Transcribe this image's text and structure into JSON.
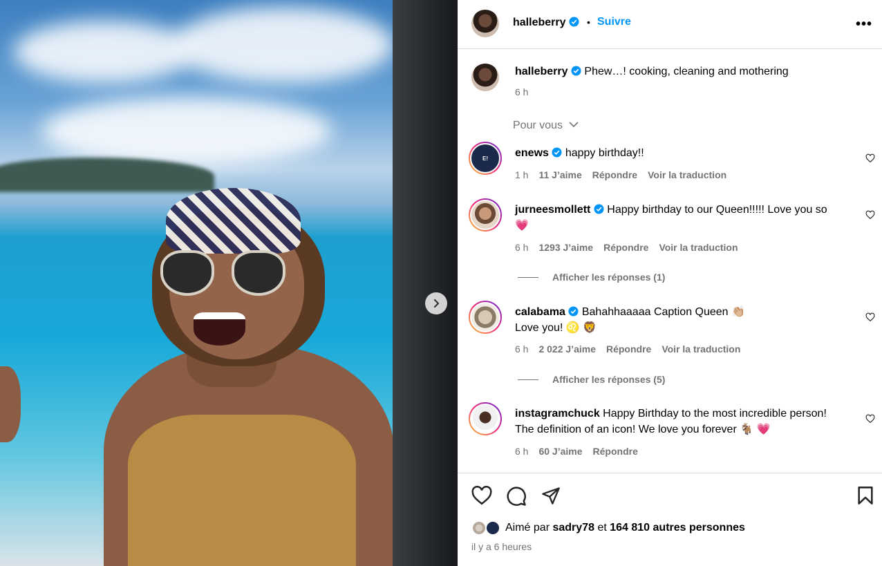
{
  "post": {
    "username": "halleberry",
    "separator": "•",
    "follow_label": "Suivre",
    "more_icon": "more-horizontal-icon"
  },
  "caption": {
    "username": "halleberry",
    "text": "Phew…! cooking, cleaning and mothering",
    "time": "6 h"
  },
  "comments_filter": {
    "label": "Pour vous"
  },
  "comments": [
    {
      "username": "enews",
      "text": "happy birthday!!",
      "time": "1 h",
      "likes": "11 J’aime",
      "reply": "Répondre",
      "translate": "Voir la traduction"
    },
    {
      "username": "jurneesmollett",
      "text": "Happy birthday to our Queen!!!!! Love you so",
      "text2": "💗",
      "time": "6 h",
      "likes": "1293 J’aime",
      "reply": "Répondre",
      "translate": "Voir la traduction",
      "replies": "Afficher les réponses (1)"
    },
    {
      "username": "calabama",
      "text": "Bahahhaaaaa Caption Queen 👏🏼",
      "text2": "Love you! ♌ 🦁",
      "time": "6 h",
      "likes": "2 022 J’aime",
      "reply": "Répondre",
      "translate": "Voir la traduction",
      "replies": "Afficher les réponses (5)"
    },
    {
      "username": "instagramchuck",
      "text": "Happy Birthday to the most incredible person!",
      "text2": "The definition of an icon! We love you forever 🐐 💗",
      "time": "6 h",
      "likes": "60 J’aime",
      "reply": "Répondre"
    }
  ],
  "likes_summary": {
    "prefix": "Aimé par",
    "user": "sadry78",
    "and": "et",
    "count": "164 810 autres personnes"
  },
  "posted_time": "il y a 6 heures",
  "colors": {
    "accent": "#0095f6",
    "verified": "#0095f6",
    "muted": "#737373"
  }
}
